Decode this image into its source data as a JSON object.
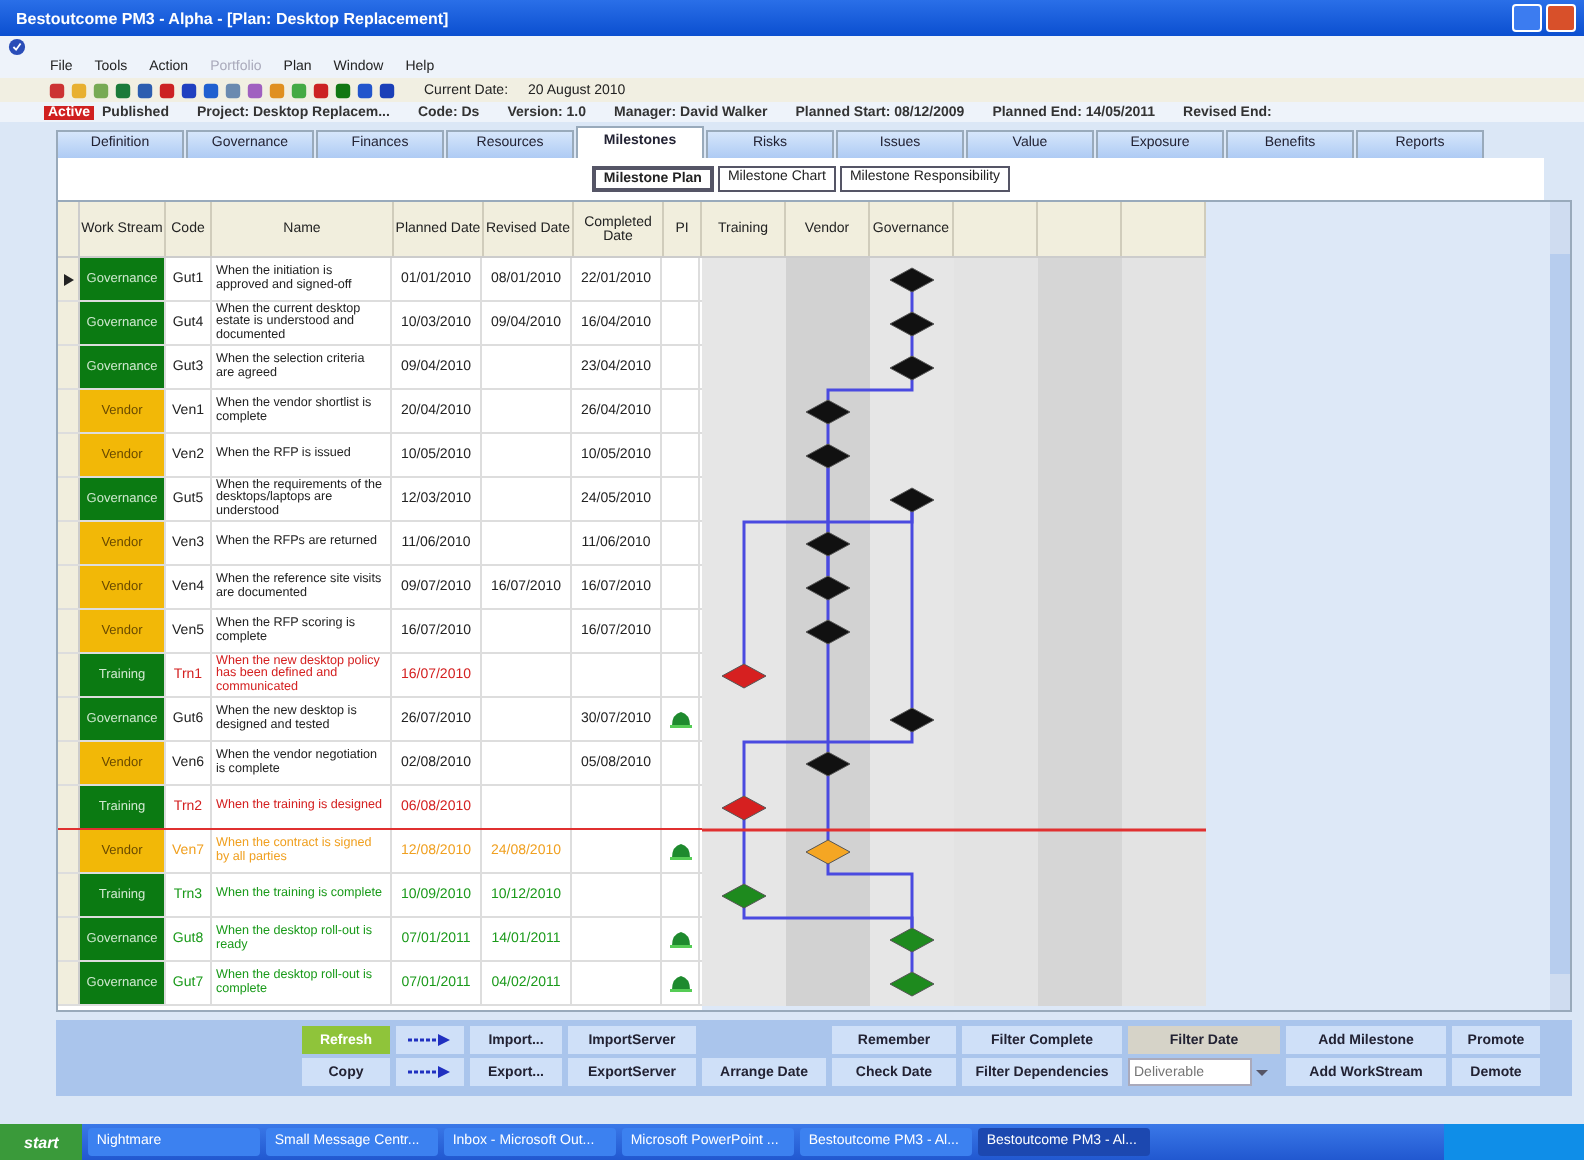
{
  "window": {
    "title": "Bestoutcome PM3 - Alpha - [Plan: Desktop Replacement]"
  },
  "menu": [
    {
      "label": "File",
      "disabled": false
    },
    {
      "label": "Tools",
      "disabled": false
    },
    {
      "label": "Action",
      "disabled": false
    },
    {
      "label": "Portfolio",
      "disabled": true
    },
    {
      "label": "Plan",
      "disabled": false
    },
    {
      "label": "Window",
      "disabled": false
    },
    {
      "label": "Help",
      "disabled": false
    }
  ],
  "toolbar": {
    "current_date_label": "Current Date:",
    "current_date": "20 August 2010"
  },
  "info": {
    "status": "Active",
    "state": "Published",
    "fields": [
      "Project: Desktop Replacem...",
      "Code: Ds",
      "Version: 1.0",
      "Manager: David Walker",
      "Planned Start: 08/12/2009",
      "Planned End: 14/05/2011",
      "Revised End:"
    ]
  },
  "tabs": [
    {
      "label": "Definition",
      "selected": false
    },
    {
      "label": "Governance",
      "selected": false
    },
    {
      "label": "Finances",
      "selected": false
    },
    {
      "label": "Resources",
      "selected": false
    },
    {
      "label": "Milestones",
      "selected": true
    },
    {
      "label": "Risks",
      "selected": false
    },
    {
      "label": "Issues",
      "selected": false
    },
    {
      "label": "Value",
      "selected": false
    },
    {
      "label": "Exposure",
      "selected": false
    },
    {
      "label": "Benefits",
      "selected": false
    },
    {
      "label": "Reports",
      "selected": false
    }
  ],
  "subtabs": [
    {
      "label": "Milestone Plan",
      "selected": true
    },
    {
      "label": "Milestone Chart",
      "selected": false
    },
    {
      "label": "Milestone Responsibility",
      "selected": false
    }
  ],
  "table": {
    "columns": [
      "Work Stream",
      "Code",
      "Name",
      "Planned Date",
      "Revised Date",
      "Completed Date",
      "PI"
    ],
    "lanes": [
      {
        "kind": "training",
        "label": "Training"
      },
      {
        "kind": "vendor",
        "label": "Vendor"
      },
      {
        "kind": "governance",
        "label": "Governance"
      },
      {
        "kind": "blank"
      },
      {
        "kind": "blank"
      },
      {
        "kind": "blank"
      }
    ],
    "rows": [
      {
        "selected": true,
        "kind": "governance",
        "workstream": "Governance",
        "color": "#0b7a12",
        "code": "Gut1",
        "name": "When the initiation is approved and signed-off",
        "planned": "01/01/2010",
        "revised": "08/01/2010",
        "completed": "22/01/2010",
        "late": false,
        "at_risk": false,
        "on_track": false,
        "flagged": false,
        "today_line": false
      },
      {
        "selected": false,
        "kind": "governance",
        "workstream": "Governance",
        "color": "#0b7a12",
        "code": "Gut4",
        "name": "When the current desktop estate is understood and documented",
        "planned": "10/03/2010",
        "revised": "09/04/2010",
        "completed": "16/04/2010",
        "late": false,
        "at_risk": false,
        "on_track": false,
        "flagged": false,
        "today_line": false
      },
      {
        "selected": false,
        "kind": "governance",
        "workstream": "Governance",
        "color": "#0b7a12",
        "code": "Gut3",
        "name": "When the selection criteria are agreed",
        "planned": "09/04/2010",
        "completed": "23/04/2010",
        "late": false,
        "at_risk": false,
        "on_track": false,
        "flagged": false,
        "today_line": false
      },
      {
        "selected": false,
        "kind": "vendor",
        "workstream": "Vendor",
        "color": "#f2b807",
        "code": "Ven1",
        "name": "When the vendor shortlist is complete",
        "planned": "20/04/2010",
        "completed": "26/04/2010",
        "late": false,
        "at_risk": false,
        "on_track": false,
        "flagged": false,
        "today_line": false
      },
      {
        "selected": false,
        "kind": "vendor",
        "workstream": "Vendor",
        "color": "#f2b807",
        "code": "Ven2",
        "name": "When the RFP is issued",
        "planned": "10/05/2010",
        "completed": "10/05/2010",
        "late": false,
        "at_risk": false,
        "on_track": false,
        "flagged": false,
        "today_line": false
      },
      {
        "selected": false,
        "kind": "governance",
        "workstream": "Governance",
        "color": "#0b7a12",
        "code": "Gut5",
        "name": "When the requirements of the desktops/laptops are understood",
        "planned": "12/03/2010",
        "completed": "24/05/2010",
        "late": false,
        "at_risk": false,
        "on_track": false,
        "flagged": false,
        "today_line": false
      },
      {
        "selected": false,
        "kind": "vendor",
        "workstream": "Vendor",
        "color": "#f2b807",
        "code": "Ven3",
        "name": "When the RFPs are returned",
        "planned": "11/06/2010",
        "completed": "11/06/2010",
        "late": false,
        "at_risk": false,
        "on_track": false,
        "flagged": false,
        "today_line": false
      },
      {
        "selected": false,
        "kind": "vendor",
        "workstream": "Vendor",
        "color": "#f2b807",
        "code": "Ven4",
        "name": "When the reference site visits are documented",
        "planned": "09/07/2010",
        "revised": "16/07/2010",
        "completed": "16/07/2010",
        "late": false,
        "at_risk": false,
        "on_track": false,
        "flagged": false,
        "today_line": false
      },
      {
        "selected": false,
        "kind": "vendor",
        "workstream": "Vendor",
        "color": "#f2b807",
        "code": "Ven5",
        "name": "When the RFP scoring is complete",
        "planned": "16/07/2010",
        "completed": "16/07/2010",
        "late": false,
        "at_risk": false,
        "on_track": false,
        "flagged": false,
        "today_line": false
      },
      {
        "selected": false,
        "kind": "training",
        "workstream": "Training",
        "color": "#0b7a12",
        "code": "Trn1",
        "name": "When the new desktop policy has been defined and communicated",
        "planned": "16/07/2010",
        "late": true,
        "at_risk": false,
        "on_track": false,
        "flagged": false,
        "today_line": false
      },
      {
        "selected": false,
        "kind": "governance",
        "workstream": "Governance",
        "color": "#0b7a12",
        "code": "Gut6",
        "name": "When the new desktop is designed and tested",
        "planned": "26/07/2010",
        "completed": "30/07/2010",
        "late": false,
        "at_risk": false,
        "on_track": false,
        "flagged": true,
        "today_line": false
      },
      {
        "selected": false,
        "kind": "vendor",
        "workstream": "Vendor",
        "color": "#f2b807",
        "code": "Ven6",
        "name": "When the vendor negotiation is complete",
        "planned": "02/08/2010",
        "completed": "05/08/2010",
        "late": false,
        "at_risk": false,
        "on_track": false,
        "flagged": false,
        "today_line": false
      },
      {
        "selected": false,
        "kind": "training",
        "workstream": "Training",
        "color": "#0b7a12",
        "code": "Trn2",
        "name": "When the training is designed",
        "planned": "06/08/2010",
        "late": true,
        "at_risk": false,
        "on_track": false,
        "flagged": false,
        "today_line": true
      },
      {
        "selected": false,
        "kind": "vendor",
        "workstream": "Vendor",
        "color": "#f2b807",
        "code": "Ven7",
        "name": "When the contract is signed by all parties",
        "planned": "12/08/2010",
        "revised": "24/08/2010",
        "late": false,
        "at_risk": true,
        "on_track": false,
        "flagged": true,
        "today_line": false
      },
      {
        "selected": false,
        "kind": "training",
        "workstream": "Training",
        "color": "#0b7a12",
        "code": "Trn3",
        "name": "When the training is complete",
        "planned": "10/09/2010",
        "revised": "10/12/2010",
        "late": false,
        "at_risk": false,
        "on_track": true,
        "flagged": false,
        "today_line": false
      },
      {
        "selected": false,
        "kind": "governance",
        "workstream": "Governance",
        "color": "#0b7a12",
        "code": "Gut8",
        "name": "When the desktop roll-out is ready",
        "planned": "07/01/2011",
        "revised": "14/01/2011",
        "late": false,
        "at_risk": false,
        "on_track": true,
        "flagged": true,
        "today_line": false
      },
      {
        "selected": false,
        "kind": "governance",
        "workstream": "Governance",
        "color": "#0b7a12",
        "code": "Gut7",
        "name": "When the desktop roll-out is complete",
        "planned": "07/01/2011",
        "revised": "04/02/2011",
        "late": false,
        "at_risk": false,
        "on_track": true,
        "flagged": true,
        "today_line": false
      }
    ]
  },
  "buttons": [
    [
      {
        "kind": "accent",
        "label": "Refresh"
      },
      {
        "kind": "arrow"
      },
      {
        "kind": "button",
        "label": "Import..."
      },
      {
        "kind": "button",
        "label": "ImportServer"
      },
      {
        "kind": "empty"
      },
      {
        "kind": "button",
        "label": "Remember"
      },
      {
        "kind": "button",
        "label": "Filter Complete"
      },
      {
        "kind": "pressed",
        "label": "Filter Date"
      },
      {
        "kind": "button",
        "label": "Add Milestone"
      },
      {
        "kind": "button",
        "label": "Promote"
      }
    ],
    [
      {
        "kind": "button",
        "label": "Copy"
      },
      {
        "kind": "arrow"
      },
      {
        "kind": "button",
        "label": "Export..."
      },
      {
        "kind": "button",
        "label": "ExportServer"
      },
      {
        "kind": "button",
        "label": "Arrange Date"
      },
      {
        "kind": "button",
        "label": "Check Date"
      },
      {
        "kind": "button",
        "label": "Filter Dependencies"
      },
      {
        "kind": "dropdown",
        "placeholder": "Deliverable"
      },
      {
        "kind": "button",
        "label": "Add WorkStream"
      },
      {
        "kind": "button",
        "label": "Demote"
      }
    ]
  ],
  "taskbar": {
    "start": "start",
    "items": [
      {
        "label": "Nightmare",
        "selected": false
      },
      {
        "label": "Small Message Centr...",
        "selected": false
      },
      {
        "label": "Inbox - Microsoft Out...",
        "selected": false
      },
      {
        "label": "Microsoft PowerPoint ...",
        "selected": false
      },
      {
        "label": "Bestoutcome PM3 - Al...",
        "selected": false
      },
      {
        "label": "Bestoutcome PM3 - Al...",
        "selected": true
      }
    ]
  }
}
